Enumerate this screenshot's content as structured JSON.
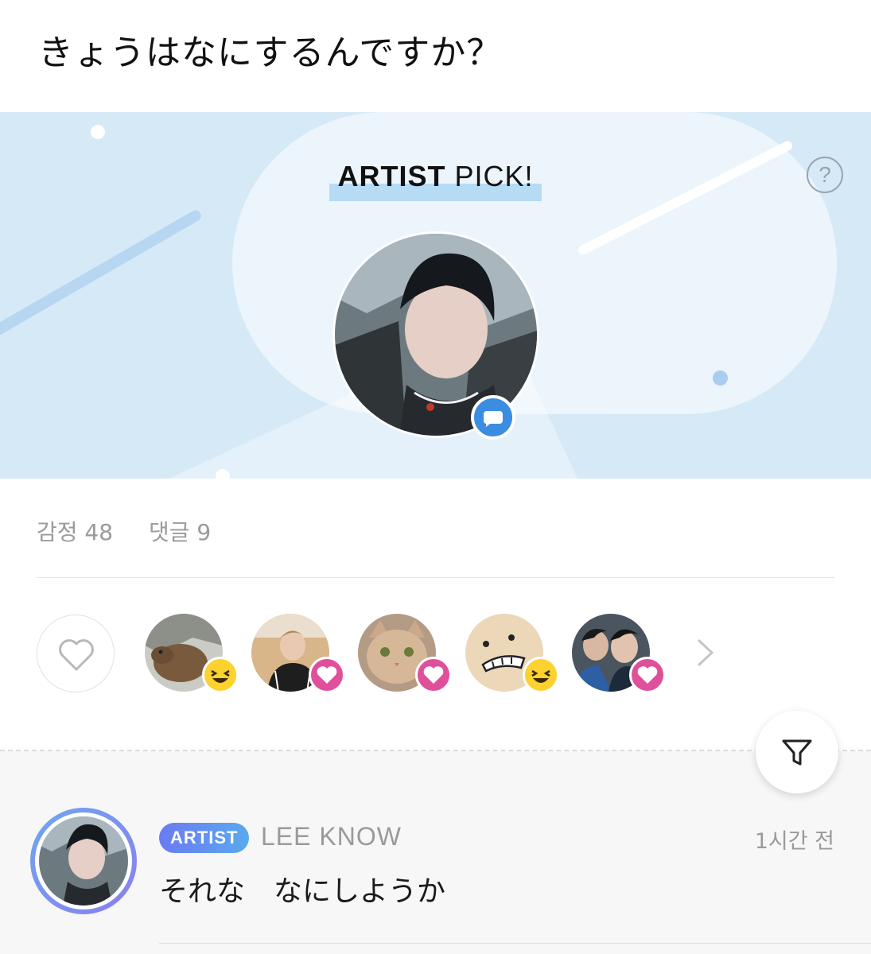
{
  "post": {
    "title": "きょうはなにするんですか？"
  },
  "banner": {
    "title_strong": "ARTIST",
    "title_rest": " PICK!",
    "help_symbol": "?"
  },
  "counts": {
    "emotions_label": "감정 48",
    "comments_label": "댓글 9"
  },
  "reactions": {
    "items": [
      {
        "avatar": "capybara",
        "emotion": "laugh"
      },
      {
        "avatar": "person-black-jacket",
        "emotion": "heart"
      },
      {
        "avatar": "cat",
        "emotion": "heart"
      },
      {
        "avatar": "cartoon-face",
        "emotion": "laugh"
      },
      {
        "avatar": "two-people",
        "emotion": "heart"
      }
    ]
  },
  "comment": {
    "badge": "ARTIST",
    "author": "LEE KNOW",
    "time": "1시간 전",
    "text": "それな　なにしようか"
  },
  "colors": {
    "banner": "#d6e9f7",
    "accent_blue": "#3b8de2",
    "heart_pink": "#e0509a",
    "laugh_yellow": "#fcd22e"
  }
}
